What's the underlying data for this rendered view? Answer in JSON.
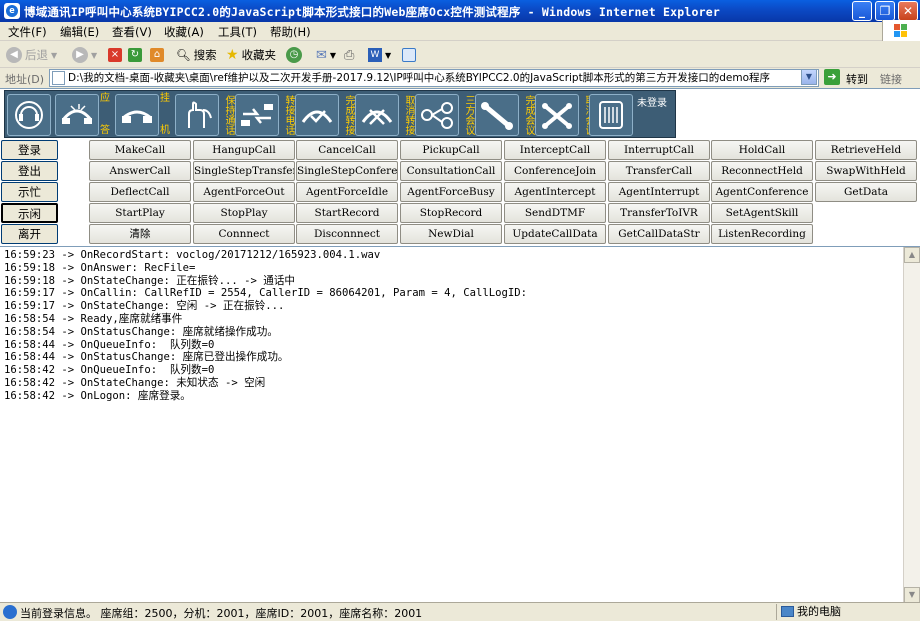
{
  "window": {
    "title": "博域通讯IP呼叫中心系统BYIPCC2.0的JavaScript脚本形式接口的Web座席Ocx控件测试程序 - Windows Internet Explorer"
  },
  "menu": {
    "items": [
      "文件(F)",
      "编辑(E)",
      "查看(V)",
      "收藏(A)",
      "工具(T)",
      "帮助(H)"
    ]
  },
  "toolbar": {
    "back": "后退",
    "search": "搜索",
    "favorites": "收藏夹"
  },
  "address": {
    "label": "地址(D)",
    "value": "D:\\我的文档-桌面-收藏夹\\桌面\\ref维护以及二次开发手册-2017.9.12\\IP呼叫中心系统BYIPCC2.0的JavaScript脚本形式的第三方开发接口的demo程序",
    "go": "转到",
    "links": "链接"
  },
  "iconbar": {
    "items": [
      {
        "name": "answer",
        "label": "应答"
      },
      {
        "name": "hangup",
        "label": "挂机"
      },
      {
        "name": "hold",
        "label": "保持通话"
      },
      {
        "name": "transfer",
        "label": "转接电话"
      },
      {
        "name": "complete-transfer",
        "label": "完成转接"
      },
      {
        "name": "cancel-transfer",
        "label": "取消转接"
      },
      {
        "name": "conference",
        "label": "三方会议"
      },
      {
        "name": "complete-conference",
        "label": "完成会议"
      },
      {
        "name": "cancel-conference",
        "label": "取消会议"
      },
      {
        "name": "keypad",
        "label": ""
      }
    ],
    "status": "未登录"
  },
  "left_buttons": [
    "登录",
    "登出",
    "示忙",
    "示闲",
    "离开"
  ],
  "function_buttons": [
    [
      "MakeCall",
      "HangupCall",
      "CancelCall",
      "PickupCall",
      "InterceptCall",
      "InterruptCall",
      "HoldCall",
      "RetrieveHeld"
    ],
    [
      "AnswerCall",
      "SingleStepTransfer",
      "SingleStepConference",
      "ConsultationCall",
      "ConferenceJoin",
      "TransferCall",
      "ReconnectHeld",
      "SwapWithHeld"
    ],
    [
      "DeflectCall",
      "AgentForceOut",
      "AgentForceIdle",
      "AgentForceBusy",
      "AgentIntercept",
      "AgentInterrupt",
      "AgentConference",
      "GetData"
    ],
    [
      "StartPlay",
      "StopPlay",
      "StartRecord",
      "StopRecord",
      "SendDTMF",
      "TransferToIVR",
      "SetAgentSkill"
    ],
    [
      "清除",
      "Connnect",
      "Disconnnect",
      "NewDial",
      "UpdateCallData",
      "GetCallDataStr",
      "ListenRecording"
    ]
  ],
  "log": [
    "16:59:23 -> OnRecordStart: voclog/20171212/165923.004.1.wav",
    "16:59:18 -> OnAnswer: RecFile=",
    "16:59:18 -> OnStateChange: 正在振铃... -> 通话中",
    "16:59:17 -> OnCallin: CallRefID = 2554, CallerID = 86064201, Param = 4, CallLogID:",
    "16:59:17 -> OnStateChange: 空闲 -> 正在振铃...",
    "16:58:54 -> Ready,座席就绪事件",
    "16:58:54 -> OnStatusChange: 座席就绪操作成功。",
    "16:58:44 -> OnQueueInfo:  队列数=0",
    "16:58:44 -> OnStatusChange: 座席已登出操作成功。",
    "16:58:42 -> OnQueueInfo:  队列数=0",
    "16:58:42 -> OnStateChange: 未知状态 -> 空闲",
    "16:58:42 -> OnLogon: 座席登录。"
  ],
  "statusbar": {
    "text": "当前登录信息。  座席组：2500，分机：2001，座席ID：2001，座席名称：2001",
    "zone": "我的电脑"
  }
}
